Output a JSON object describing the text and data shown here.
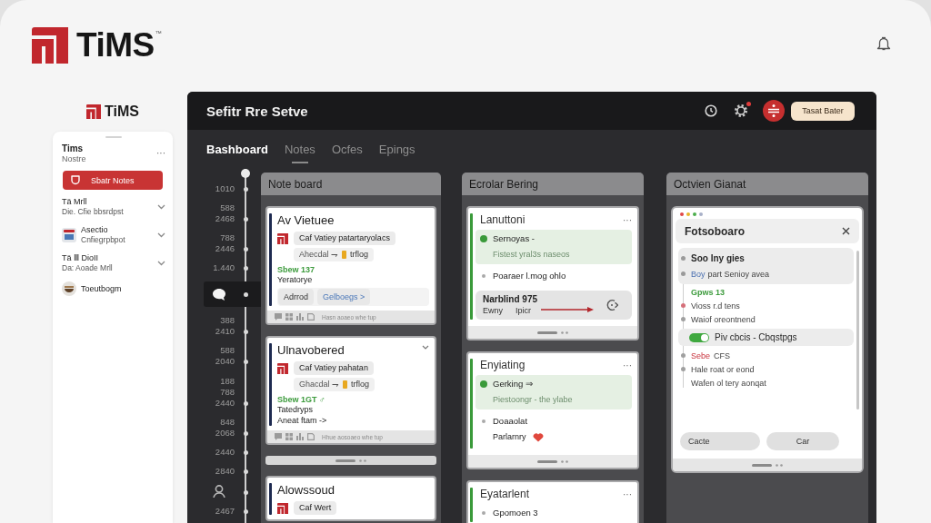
{
  "brand": {
    "name": "TiMS",
    "mark": "™"
  },
  "sidebar": {
    "brand": "TiMS",
    "title": "Tims",
    "subtitle": "Nostre",
    "menu": "···",
    "button": "Sbatr Notes",
    "items": [
      {
        "kind": "text",
        "title": "Tä Mrll",
        "subtitle": "Die. Cfie bbsrdpst",
        "expandable": true
      },
      {
        "kind": "picture",
        "title": "Asectio",
        "subtitle": "Cnfiegrpbpot",
        "expandable": true
      },
      {
        "kind": "text",
        "title": "Tä Ⅲ DioII",
        "subtitle": "Da: Aoade Mrll",
        "expandable": true
      },
      {
        "kind": "bowl",
        "title": "Toeutbogm",
        "expandable": false
      }
    ]
  },
  "window": {
    "title": "Sefitr Rre Setve",
    "button": "Tasat Bater",
    "tabs": [
      {
        "label": "Bashboard",
        "selected": true,
        "underlined": false
      },
      {
        "label": "Notes",
        "selected": false,
        "underlined": true
      },
      {
        "label": "Ocfes",
        "selected": false,
        "underlined": false
      },
      {
        "label": "Epings",
        "selected": false,
        "underlined": false
      }
    ]
  },
  "timeline": [
    {
      "kind": "label",
      "lines": [
        "1010"
      ],
      "selected": false
    },
    {
      "kind": "label",
      "lines": [
        "588",
        "2468"
      ],
      "selected": false
    },
    {
      "kind": "label",
      "lines": [
        "788",
        "2446"
      ],
      "selected": false
    },
    {
      "kind": "label",
      "lines": [
        "1.440"
      ],
      "selected": false
    },
    {
      "kind": "chat",
      "selected": true
    },
    {
      "kind": "label",
      "lines": [
        "388",
        "2410"
      ],
      "selected": false
    },
    {
      "kind": "label",
      "lines": [
        "588",
        "2040"
      ],
      "selected": false
    },
    {
      "kind": "label",
      "lines": [
        "188",
        "788",
        "2440"
      ],
      "selected": false
    },
    {
      "kind": "label",
      "lines": [
        "848",
        "2068"
      ],
      "selected": false
    },
    {
      "kind": "label",
      "lines": [
        "2440"
      ],
      "selected": false
    },
    {
      "kind": "label",
      "lines": [
        "2840"
      ],
      "selected": false
    },
    {
      "kind": "person",
      "selected": false
    },
    {
      "kind": "label",
      "lines": [
        "2467"
      ],
      "selected": false
    }
  ],
  "columns": [
    {
      "title": "Note board",
      "cards": [
        {
          "kind": "note",
          "color": "#1e2a50",
          "title": "Av Vietuee",
          "collapsible": false,
          "entry": "Caf Vatiey patartaryolacs",
          "detail": "Ahecdal ⇁",
          "tag": "trflog",
          "status": "Sbew 137",
          "note": "Yeratorye",
          "actions": [
            {
              "kind": "pill",
              "label": "Adrrod"
            },
            {
              "kind": "link",
              "label": "Gelboegs >"
            }
          ],
          "footer": "Hasn aoaeo whe tup"
        },
        {
          "kind": "note",
          "color": "#1e2a50",
          "title": "Ulnavobered",
          "collapsible": true,
          "entry": "Caf Vatiey pahatan",
          "detail": "Ghacdal ⇁",
          "tag": "trflog",
          "status": "Sbew 1GT ♂",
          "note": "Tatedryps",
          "link": "Aneat ftam ->",
          "footer": "Hhue aosoaeo whe tup"
        },
        {
          "kind": "collapsed"
        },
        {
          "kind": "note",
          "color": "#1e2a50",
          "title": "Alowssoud",
          "collapsible": false,
          "entry": "Caf Wert"
        }
      ]
    },
    {
      "title": "Ecrolar Bering",
      "cards": [
        {
          "kind": "steps",
          "color": "#3a9a3a",
          "title": "Lanuttoni",
          "menu": "···",
          "steps": [
            {
              "title": "Sernoyas -",
              "detail": "Fistest yral3s naseos",
              "highlighted": true,
              "liked": false
            },
            {
              "title": "Poaraer l.mog ohlo",
              "highlighted": false,
              "liked": false
            }
          ],
          "transfer": {
            "name": "Narblind 975",
            "from": "Ewny",
            "to": "Ipicr"
          }
        },
        {
          "kind": "steps",
          "color": "#3a9a3a",
          "title": "Enyiating",
          "menu": "···",
          "steps": [
            {
              "title": "Gerking ⇒",
              "detail": "Piestoongr - the ylabe",
              "highlighted": true,
              "liked": false
            },
            {
              "title": "Doaaolat",
              "detail": "Parlarnry",
              "highlighted": false,
              "liked": true
            }
          ]
        },
        {
          "kind": "steps",
          "color": "#3a9a3a",
          "title": "Eyatarlent",
          "menu": "···",
          "steps": [
            {
              "title": "Gpomoen 3",
              "highlighted": false,
              "liked": false
            }
          ]
        }
      ]
    },
    {
      "title": "Octvien Gianat",
      "cards": [
        {
          "kind": "dialog",
          "title": "Fotsoboaro",
          "rows": [
            {
              "kind": "group",
              "title": "Soo Iny gies",
              "tag": "Boy",
              "detail": "part Senioy avea"
            },
            {
              "kind": "status",
              "text": "Gpws 13"
            },
            {
              "kind": "item",
              "text": "Vioss r.d tens",
              "color": "#d5707a"
            },
            {
              "kind": "item",
              "text": "Waiof oreontnend",
              "color": "#a0a0a0"
            },
            {
              "kind": "toggle",
              "text": "Piv cbcis - Cbqstpgs",
              "on": true
            },
            {
              "kind": "flag",
              "flag": "Sebe",
              "text": "CFS",
              "color": "#a0a0a0"
            },
            {
              "kind": "item",
              "text": "Hale roat or eond",
              "color": "#a0a0a0"
            },
            {
              "kind": "plain",
              "text": "Wafen ol tery aonqat"
            }
          ],
          "buttons": [
            "Cacte",
            "Car"
          ]
        }
      ]
    }
  ]
}
